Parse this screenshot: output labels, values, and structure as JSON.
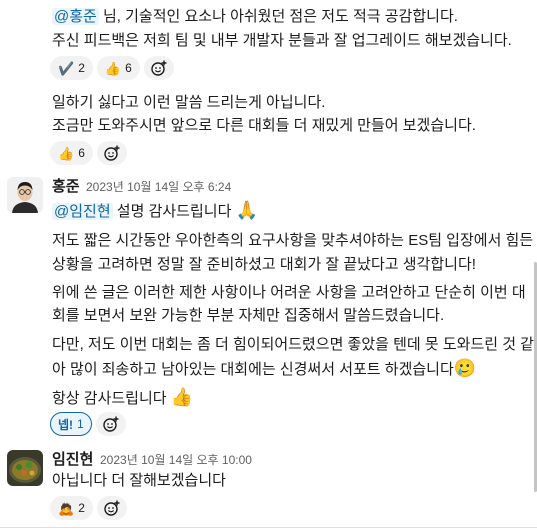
{
  "messages": [
    {
      "lines": [
        {
          "mention": "@홍준",
          "text": " 님, 기술적인 요소나 아쉬웠던 점은 저도 적극 공감합니다."
        },
        {
          "text": "주신 피드백은 저희 팀 및 내부 개발자 분들과 잘 업그레이드 해보겠습니다."
        }
      ],
      "reactions": [
        {
          "emoji": "✔️",
          "count": "2"
        },
        {
          "emoji": "👍",
          "count": "6"
        }
      ]
    },
    {
      "lines": [
        {
          "text": "일하기 싫다고 이런 말씀 드리는게 아닙니다."
        },
        {
          "text": "조금만 도와주시면 앞으로 다른 대회들 더 재밌게 만들어 보겠습니다."
        }
      ],
      "reactions": [
        {
          "emoji": "👍",
          "count": "6"
        }
      ]
    },
    {
      "author": "홍준",
      "timestamp": "2023년 10월 14일 오후 6:24",
      "first_line": {
        "mention": "@임진현",
        "text": " 설명 감사드립니다",
        "emoji": "🙏"
      },
      "para1": [
        "저도 짧은 시간동안 우아한측의 요구사항을 맞추셔야하는 ES팀 입장에서 힘든",
        "상황을 고려하면 정말 잘 준비하셨고 대회가 잘 끝났다고 생각합니다!"
      ],
      "para2": [
        "위에 쓴 글은 이러한 제한 사항이나 어려운 사항을 고려안하고 단순히 이번 대",
        "회를 보면서 보완 가능한 부분 자체만 집중해서 말씀드렸습니다."
      ],
      "para3": [
        "다만, 저도 이번 대회는 좀 더 힘이되어드렸으면 좋았을 텐데 못 도와드린 것 같",
        "아 많이 죄송하고 남아있는 대회에는 신경써서 서포트 하겠습니다"
      ],
      "para3_emoji": "🥲",
      "para4": {
        "text": "항상 감사드립니다 ",
        "emoji": "👍"
      },
      "reactions": [
        {
          "label": "넵!",
          "count": "1",
          "active": true
        }
      ]
    },
    {
      "author": "임진현",
      "timestamp": "2023년 10월 14일 오후 10:00",
      "text": "아닙니다 더 잘해보겠습니다",
      "reactions": [
        {
          "emoji": "🙇",
          "count": "2"
        }
      ]
    }
  ],
  "icons": {
    "add_reaction": "add-reaction-icon"
  }
}
